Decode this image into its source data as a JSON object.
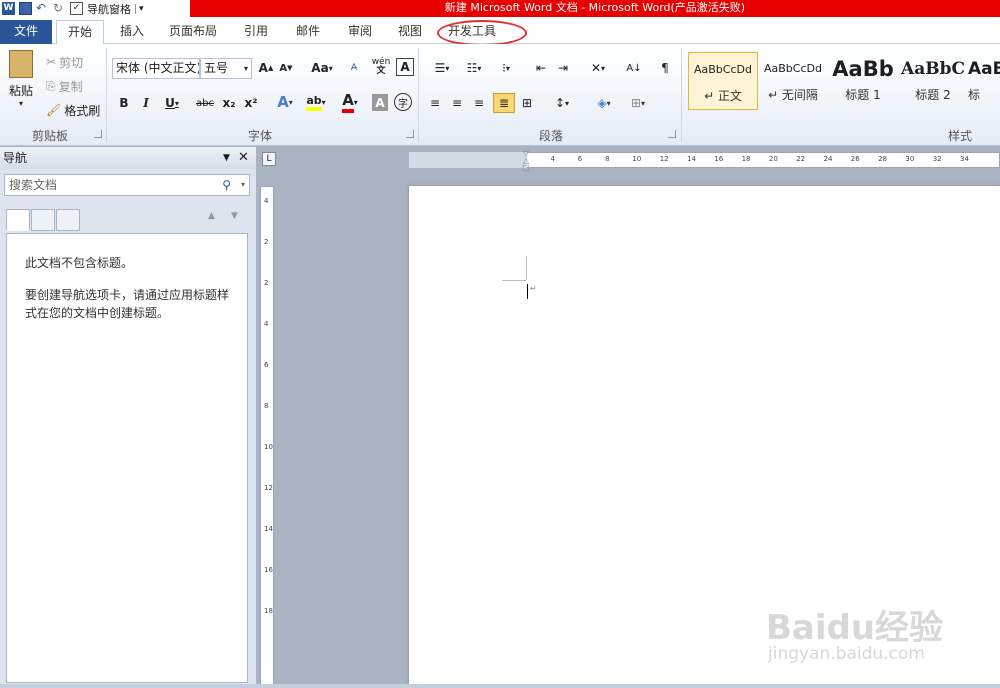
{
  "titlebar": {
    "qat_checkbox_label": "导航窗格",
    "title": "新建 Microsoft Word 文档 - Microsoft Word(产品激活失败)"
  },
  "tabs": [
    "文件",
    "开始",
    "插入",
    "页面布局",
    "引用",
    "邮件",
    "审阅",
    "视图",
    "开发工具"
  ],
  "clipboard": {
    "paste": "粘贴",
    "cut": "剪切",
    "copy": "复制",
    "format_painter": "格式刷",
    "label": "剪贴板"
  },
  "font": {
    "name": "宋体 (中文正文)",
    "size": "五号",
    "label": "字体",
    "grow": "A",
    "shrink": "A",
    "case": "Aa",
    "phonetic": "wén",
    "bold": "B",
    "italic": "I",
    "underline": "U",
    "strike": "abc",
    "sub": "x₂",
    "sup": "x²",
    "effects": "A",
    "highlight": "ab",
    "color": "A",
    "shade": "A",
    "enclose": "字"
  },
  "paragraph": {
    "label": "段落"
  },
  "styles": {
    "label": "样式",
    "items": [
      {
        "preview": "AaBbCcDd",
        "name": "↵ 正文"
      },
      {
        "preview": "AaBbCcDd",
        "name": "↵ 无间隔"
      },
      {
        "preview": "AaBb",
        "name": "标题 1"
      },
      {
        "preview": "AaBbC",
        "name": "标题 2"
      },
      {
        "preview": "AaB",
        "name": "标"
      }
    ]
  },
  "nav": {
    "title": "导航",
    "search_placeholder": "搜索文档",
    "msg1": "此文档不包含标题。",
    "msg2": "要创建导航选项卡，请通过应用标题样式在您的文档中创建标题。"
  },
  "ruler": {
    "h_ticks": [
      "8",
      "6",
      "4",
      "2",
      "2",
      "4",
      "6",
      "8",
      "10",
      "12",
      "14",
      "16",
      "18",
      "20",
      "22",
      "24",
      "26",
      "28",
      "30",
      "32",
      "34"
    ],
    "v_ticks": [
      "4",
      "2",
      "2",
      "4",
      "6",
      "8",
      "10",
      "12",
      "14",
      "16",
      "18"
    ]
  },
  "watermark": {
    "brand": "Baidu经验",
    "url": "jingyan.baidu.com"
  },
  "colors": {
    "file_tab": "#2a5699",
    "title_bar": "#e60000",
    "highlight_circle": "#e03030"
  }
}
